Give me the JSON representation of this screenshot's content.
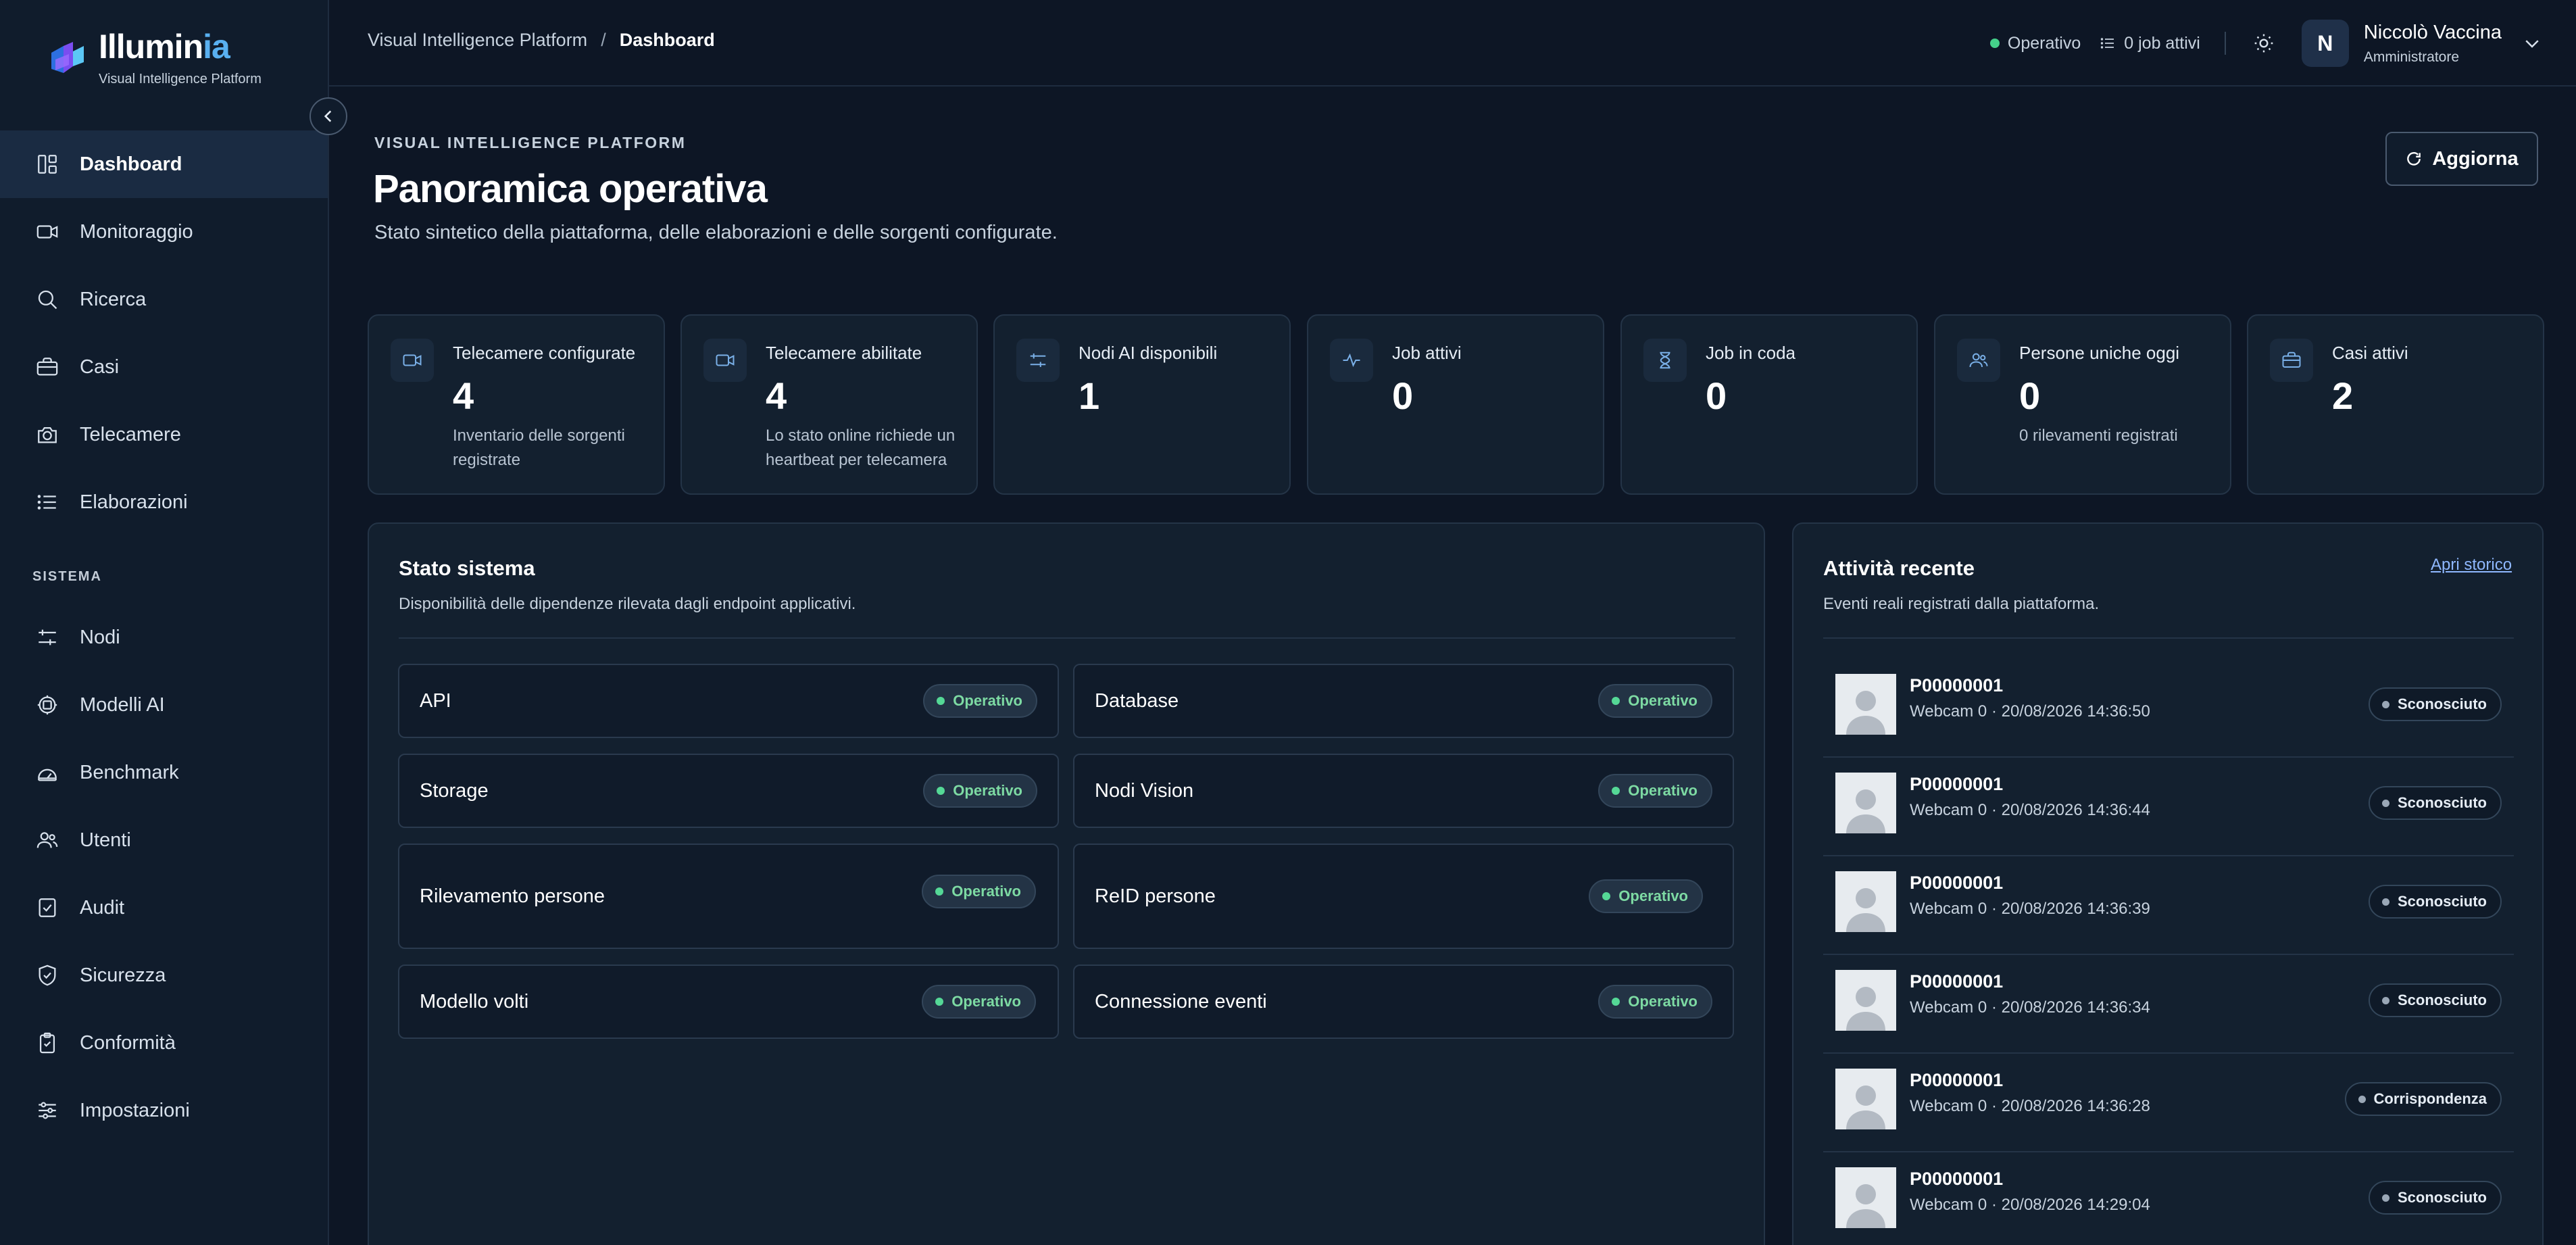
{
  "brand": {
    "name_main": "Illumin",
    "name_accent": "ia",
    "subtitle": "Visual Intelligence Platform"
  },
  "sidebar": {
    "items": [
      {
        "label": "Dashboard",
        "icon": "dashboard-icon",
        "active": true
      },
      {
        "label": "Monitoraggio",
        "icon": "video-icon"
      },
      {
        "label": "Ricerca",
        "icon": "search-icon"
      },
      {
        "label": "Casi",
        "icon": "briefcase-icon"
      },
      {
        "label": "Telecamere",
        "icon": "camera-icon"
      },
      {
        "label": "Elaborazioni",
        "icon": "list-icon"
      }
    ],
    "section_label": "SISTEMA",
    "system_items": [
      {
        "label": "Nodi",
        "icon": "server-icon"
      },
      {
        "label": "Modelli AI",
        "icon": "chip-icon"
      },
      {
        "label": "Benchmark",
        "icon": "gauge-icon"
      },
      {
        "label": "Utenti",
        "icon": "users-icon"
      },
      {
        "label": "Audit",
        "icon": "checklist-icon"
      },
      {
        "label": "Sicurezza",
        "icon": "shield-icon"
      },
      {
        "label": "Conformità",
        "icon": "clipboard-icon"
      },
      {
        "label": "Impostazioni",
        "icon": "sliders-icon"
      }
    ]
  },
  "topbar": {
    "breadcrumb_root": "Visual Intelligence Platform",
    "breadcrumb_sep": "/",
    "breadcrumb_current": "Dashboard",
    "status": "Operativo",
    "jobs": "0 job attivi",
    "user": {
      "initial": "N",
      "name": "Niccolò Vaccina",
      "role": "Amministratore"
    }
  },
  "header": {
    "eyebrow": "VISUAL INTELLIGENCE PLATFORM",
    "title": "Panoramica operativa",
    "subtitle": "Stato sintetico della piattaforma, delle elaborazioni e delle sorgenti configurate.",
    "refresh_label": "Aggiorna"
  },
  "kpis": [
    {
      "label": "Telecamere configurate",
      "value": "4",
      "desc": "Inventario delle sorgenti registrate",
      "icon": "video-icon"
    },
    {
      "label": "Telecamere abilitate",
      "value": "4",
      "desc": "Lo stato online richiede un heartbeat per telecamera",
      "icon": "video-icon"
    },
    {
      "label": "Nodi AI disponibili",
      "value": "1",
      "desc": "",
      "icon": "server-icon"
    },
    {
      "label": "Job attivi",
      "value": "0",
      "desc": "",
      "icon": "activity-icon"
    },
    {
      "label": "Job in coda",
      "value": "0",
      "desc": "",
      "icon": "hourglass-icon"
    },
    {
      "label": "Persone uniche oggi",
      "value": "0",
      "desc": "0 rilevamenti registrati",
      "icon": "users-icon"
    },
    {
      "label": "Casi attivi",
      "value": "2",
      "desc": "",
      "icon": "briefcase-icon"
    }
  ],
  "system": {
    "title": "Stato sistema",
    "subtitle": "Disponibilità delle dipendenze rilevata dagli endpoint applicativi.",
    "services": [
      {
        "name": "API",
        "status": "Operativo"
      },
      {
        "name": "Database",
        "status": "Operativo"
      },
      {
        "name": "Storage",
        "status": "Operativo"
      },
      {
        "name": "Nodi Vision",
        "status": "Operativo"
      },
      {
        "name": "Rilevamento persone",
        "status": "Operativo"
      },
      {
        "name": "ReID persone",
        "status": "Operativo"
      },
      {
        "name": "Modello volti",
        "status": "Operativo"
      },
      {
        "name": "Connessione eventi",
        "status": "Operativo"
      }
    ]
  },
  "activity": {
    "title": "Attività recente",
    "subtitle": "Eventi reali registrati dalla piattaforma.",
    "history_link": "Apri storico",
    "items": [
      {
        "id": "P00000001",
        "meta": "Webcam 0 · 20/08/2026 14:36:50",
        "tag": "Sconosciuto"
      },
      {
        "id": "P00000001",
        "meta": "Webcam 0 · 20/08/2026 14:36:44",
        "tag": "Sconosciuto"
      },
      {
        "id": "P00000001",
        "meta": "Webcam 0 · 20/08/2026 14:36:39",
        "tag": "Sconosciuto"
      },
      {
        "id": "P00000001",
        "meta": "Webcam 0 · 20/08/2026 14:36:34",
        "tag": "Sconosciuto"
      },
      {
        "id": "P00000001",
        "meta": "Webcam 0 · 20/08/2026 14:36:28",
        "tag": "Corrispondenza"
      },
      {
        "id": "P00000001",
        "meta": "Webcam 0 · 20/08/2026 14:29:04",
        "tag": "Sconosciuto"
      }
    ]
  },
  "colors": {
    "background": "#0d1625",
    "sidebar": "#101c2c",
    "card": "#13202f",
    "ok": "#45d08a",
    "link": "#8fb8ff",
    "brand_accent": "#59b0f0"
  }
}
